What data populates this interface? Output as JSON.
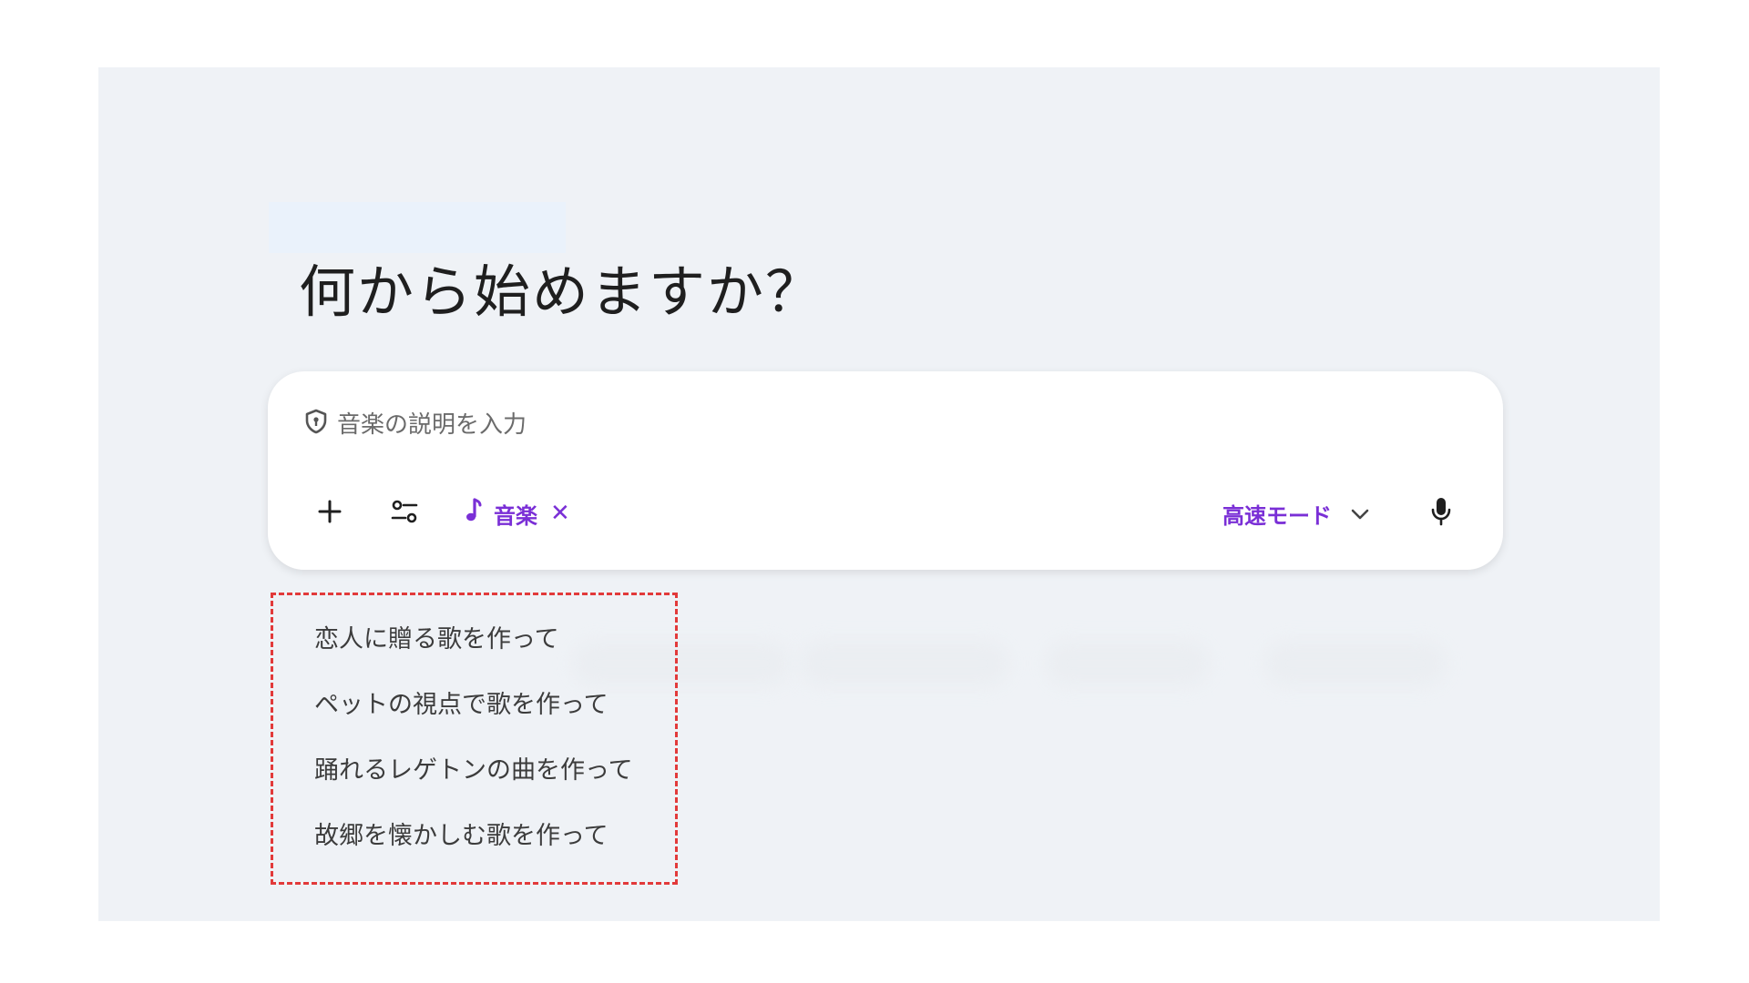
{
  "heading": {
    "title": "何から始めますか？"
  },
  "composer": {
    "placeholder": "音楽の説明を入力",
    "shield_icon": "shield-icon",
    "add_icon": "plus-icon",
    "tools_icon": "tools-icon",
    "chip": {
      "icon": "music-note-icon",
      "label": "音楽",
      "close_label": "✕"
    },
    "mode": {
      "label": "高速モード",
      "icon": "chevron-down-icon"
    },
    "mic_icon": "microphone-icon"
  },
  "suggestions": [
    "恋人に贈る歌を作って",
    "ペットの視点で歌を作って",
    "踊れるレゲトンの曲を作って",
    "故郷を懐かしむ歌を作って"
  ],
  "colors": {
    "accent": "#7a2fd6",
    "panel_bg": "#eff2f6",
    "highlight_border": "#e23a3a"
  }
}
